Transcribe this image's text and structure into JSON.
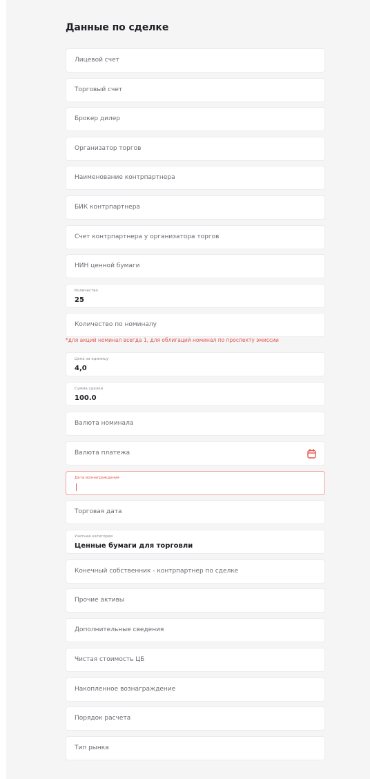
{
  "section": {
    "title": "Данные по сделке"
  },
  "fields": {
    "lic": {
      "placeholder": "Лицевой счет"
    },
    "trade_account": {
      "placeholder": "Торговый счет"
    },
    "broker": {
      "placeholder": "Брокер дилер"
    },
    "organizer": {
      "placeholder": "Организатор торгов"
    },
    "counterparty_name": {
      "placeholder": "Наименование контрпартнера"
    },
    "counterparty_bik": {
      "placeholder": "БИК контрпартнера"
    },
    "counterparty_account": {
      "placeholder": "Счет контрпартнера у организатора торгов"
    },
    "nin": {
      "placeholder": "НИН ценной бумаги"
    },
    "quantity": {
      "label": "Количество",
      "value": "25"
    },
    "quantity_nominal": {
      "placeholder": "Количество по номиналу"
    },
    "nominal_hint": "*для акций номинал всегда 1, для облигаций номинал по проспекту эмиссии",
    "unit_price": {
      "label": "Цена за единицу",
      "value": "4,0"
    },
    "deal_sum": {
      "label": "Сумма сделки",
      "value": "100.0"
    },
    "nominal_currency": {
      "placeholder": "Валюта номинала"
    },
    "payment_currency": {
      "placeholder": "Валюта платежа"
    },
    "settlement_date": {
      "label": "Дата вознаграждения"
    },
    "trade_date": {
      "placeholder": "Торговая дата"
    },
    "accounting_category": {
      "label": "Учетная категория",
      "value": "Ценные бумаги для торговли"
    },
    "beneficial_owner": {
      "placeholder": "Конечный собственник - контрпартнер по сделке"
    },
    "other_assets": {
      "placeholder": "Прочие активы"
    },
    "additional_info": {
      "placeholder": "Дополнительные сведения"
    },
    "net_value": {
      "placeholder": "Чистая стоимость ЦБ"
    },
    "accrued_reward": {
      "placeholder": "Накопленное вознаграждение"
    },
    "settlement_order": {
      "placeholder": "Порядок расчета"
    },
    "market_type": {
      "placeholder": "Тип рынка"
    }
  },
  "icons": {
    "calendar": "calendar-icon"
  },
  "colors": {
    "error": "#e2574c",
    "panel_bg": "#f5f5f6",
    "field_border": "#ececef"
  }
}
